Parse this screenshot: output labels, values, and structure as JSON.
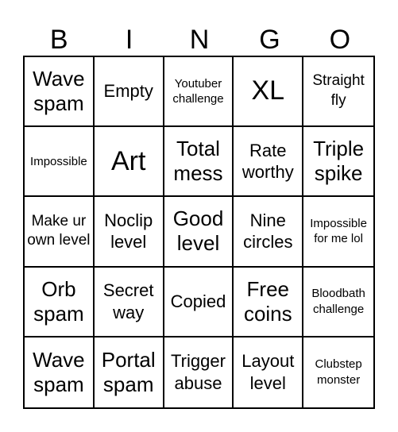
{
  "header": {
    "letters": [
      "B",
      "I",
      "N",
      "G",
      "O"
    ]
  },
  "cells": [
    [
      "Wave spam",
      "Empty",
      "Youtuber challenge",
      "XL",
      "Straight fly"
    ],
    [
      "Impossible",
      "Art",
      "Total mess",
      "Rate worthy",
      "Triple spike"
    ],
    [
      "Make ur own level",
      "Noclip level",
      "Good level",
      "Nine circles",
      "Impossible for me lol"
    ],
    [
      "Orb spam",
      "Secret way",
      "Copied",
      "Free coins",
      "Bloodbath challenge"
    ],
    [
      "Wave spam",
      "Portal spam",
      "Trigger abuse",
      "Layout level",
      "Clubstep monster"
    ]
  ]
}
